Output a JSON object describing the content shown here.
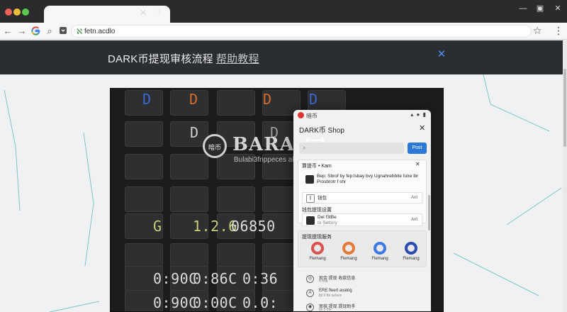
{
  "browser": {
    "tab_title": "",
    "url": "fetn.acdlo",
    "new_tab_label": "+",
    "tab_close": "✕"
  },
  "banner": {
    "title": "DARK币提现审核流程",
    "link": "帮助教程"
  },
  "hero": {
    "brand_mark": "暗币",
    "brand_name": "BARAFEXE",
    "brand_tagline": "Bulabi3fnppeces akows",
    "lcd_rows": [
      {
        "left": "G",
        "middle": "1.2.6",
        "right": "06850"
      },
      {
        "left": "0:90C",
        "middle": "0:86C",
        "right": "0:36"
      },
      {
        "left": "0:90C",
        "middle": "0:00C",
        "right": "0.0:"
      }
    ],
    "key_letters": [
      "D",
      "D",
      "D",
      "D",
      "D",
      "D"
    ],
    "colors": {
      "blue": "#3b67d6",
      "orange": "#d86a2b",
      "green": "#4ec14e",
      "lcd": "#c8cd7c"
    }
  },
  "panel": {
    "status_app": "暗币",
    "title": "DARK币 Shop",
    "search_placeholder": "",
    "search_button": "Post",
    "section1": "算提币 • Kam",
    "row1_text": "Bep: Sbrof by fep:lsbay bvy Ugnahrebbite fulre lbr Prosbrotr f shr",
    "row2_text": "钱包",
    "row2_badge": "Ant",
    "section2": "钱包提现设置",
    "row3_text": "Del f3tBe",
    "row3_sub": "to Settory",
    "row3_badge": "Ant",
    "section3": "提现提现服务",
    "apps": [
      {
        "label": "Flemang",
        "color": "#d9534f"
      },
      {
        "label": "Flemang",
        "color": "#e37a3b"
      },
      {
        "label": "Flemang",
        "color": "#3b7be3"
      },
      {
        "label": "Flemang",
        "color": "#2a4bb0"
      }
    ],
    "list": [
      {
        "icon": "◎",
        "t1": "现金 提现 收款信息",
        "t2": "ft  fnat"
      },
      {
        "icon": "A",
        "t1": "ERE fleert avalog",
        "t2": "fpl 0 fte selavs"
      },
      {
        "icon": "◉",
        "t1": "审核 提现 提现助手",
        "t2": "fpl 0 fhe"
      }
    ]
  }
}
